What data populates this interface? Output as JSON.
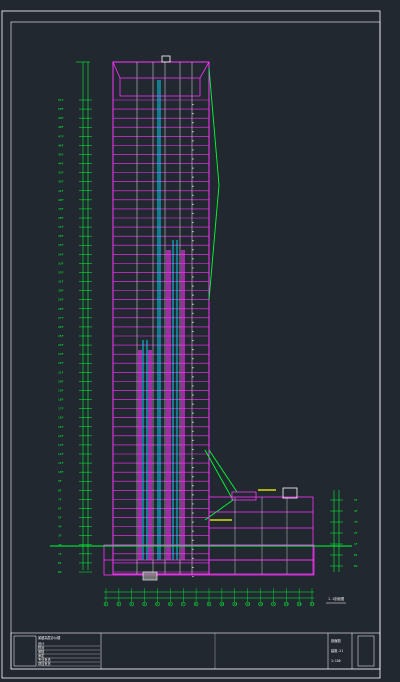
{
  "drawing": {
    "level_labels": [
      "51F",
      "50F",
      "49F",
      "48F",
      "47F",
      "46F",
      "45F",
      "44F",
      "43F",
      "42F",
      "41F",
      "40F",
      "39F",
      "38F",
      "37F",
      "36F",
      "35F",
      "34F",
      "33F",
      "32F",
      "31F",
      "30F",
      "29F",
      "28F",
      "27F",
      "26F",
      "25F",
      "24F",
      "23F",
      "22F",
      "21F",
      "20F",
      "19F",
      "18F",
      "17F",
      "16F",
      "15F",
      "14F",
      "13F",
      "12F",
      "11F",
      "10F",
      "9F",
      "8F",
      "7F",
      "6F",
      "5F",
      "4F",
      "3F",
      "2F",
      "1F",
      "B1",
      "B2"
    ],
    "podium_labels": [
      "5F",
      "4F",
      "3F",
      "2F",
      "1F",
      "B1",
      "B2"
    ],
    "axis_labels": [
      "1",
      "2",
      "3",
      "4",
      "5",
      "6",
      "7",
      "8",
      "9",
      "10",
      "11",
      "12",
      "13",
      "14",
      "15",
      "16",
      "17"
    ],
    "section_title": "1-1剖面图",
    "scale_note": "1:150",
    "title_block": {
      "project": "某超高层办公楼",
      "drawing_name": "剖面图",
      "drawing_no": "建施-21",
      "scale": "1:150",
      "rows": [
        "设计",
        "校对",
        "审核",
        "审定",
        "专业负责",
        "项目负责"
      ]
    }
  },
  "colors": {
    "background": "#212830",
    "frame": "#ffffff",
    "slab": "#ff33ff",
    "grid": "#ffffff",
    "core": "#00e5ff",
    "dim": "#00ff33",
    "highlight": "#ffff00"
  }
}
